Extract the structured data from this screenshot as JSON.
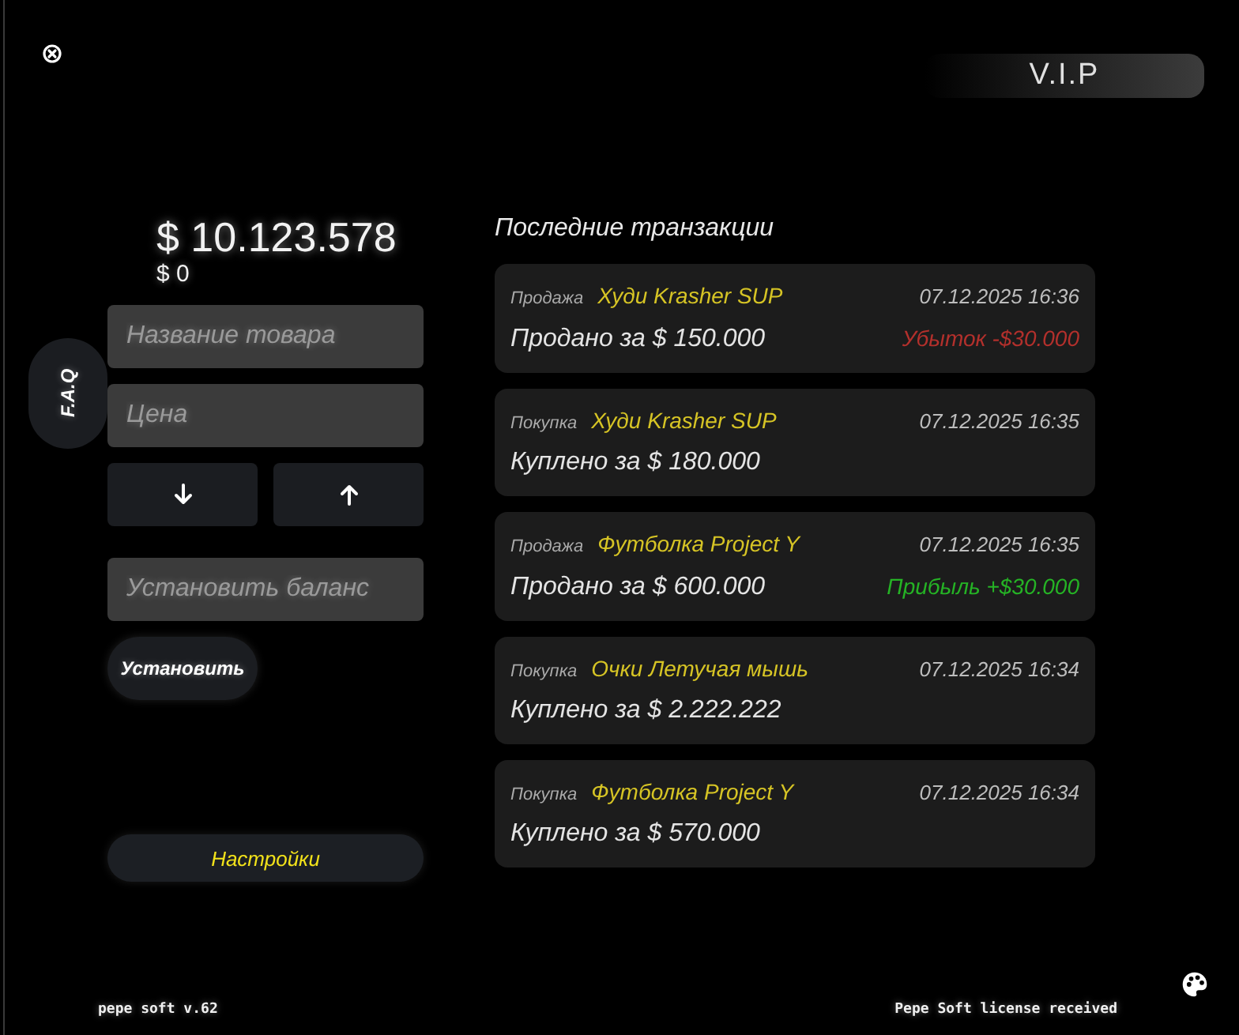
{
  "vip_badge": "V.I.P",
  "balance": {
    "amount": "$ 10.123.578",
    "secondary": "$ 0"
  },
  "faq_tab": "F.A.Q",
  "form": {
    "fields": [
      {
        "placeholder": "Название товара"
      },
      {
        "placeholder": "Цена"
      }
    ],
    "balance_field": {
      "placeholder": "Установить баланс"
    },
    "set_button": "Установить",
    "settings_button": "Настройки"
  },
  "transactions": {
    "title": "Последние транзакции",
    "items": [
      {
        "type_label": "Продажа",
        "item": "Худи Krasher SUP",
        "date": "07.12.2025 16:36",
        "summary": "Продано за $ 150.000",
        "result": {
          "kind": "loss",
          "text": "Убыток -$30.000"
        }
      },
      {
        "type_label": "Покупка",
        "item": "Худи Krasher SUP",
        "date": "07.12.2025 16:35",
        "summary": "Куплено за $ 180.000"
      },
      {
        "type_label": "Продажа",
        "item": "Футболка Project Y",
        "date": "07.12.2025 16:35",
        "summary": "Продано за $ 600.000",
        "result": {
          "kind": "profit",
          "text": "Прибыль +$30.000"
        }
      },
      {
        "type_label": "Покупка",
        "item": "Очки Летучая мышь",
        "date": "07.12.2025 16:34",
        "summary": "Куплено за $ 2.222.222"
      },
      {
        "type_label": "Покупка",
        "item": "Футболка Project Y",
        "date": "07.12.2025 16:34",
        "summary": "Куплено за $ 570.000"
      }
    ]
  },
  "footer": {
    "version": "pepe soft v.62",
    "license": "Pepe Soft license received"
  }
}
